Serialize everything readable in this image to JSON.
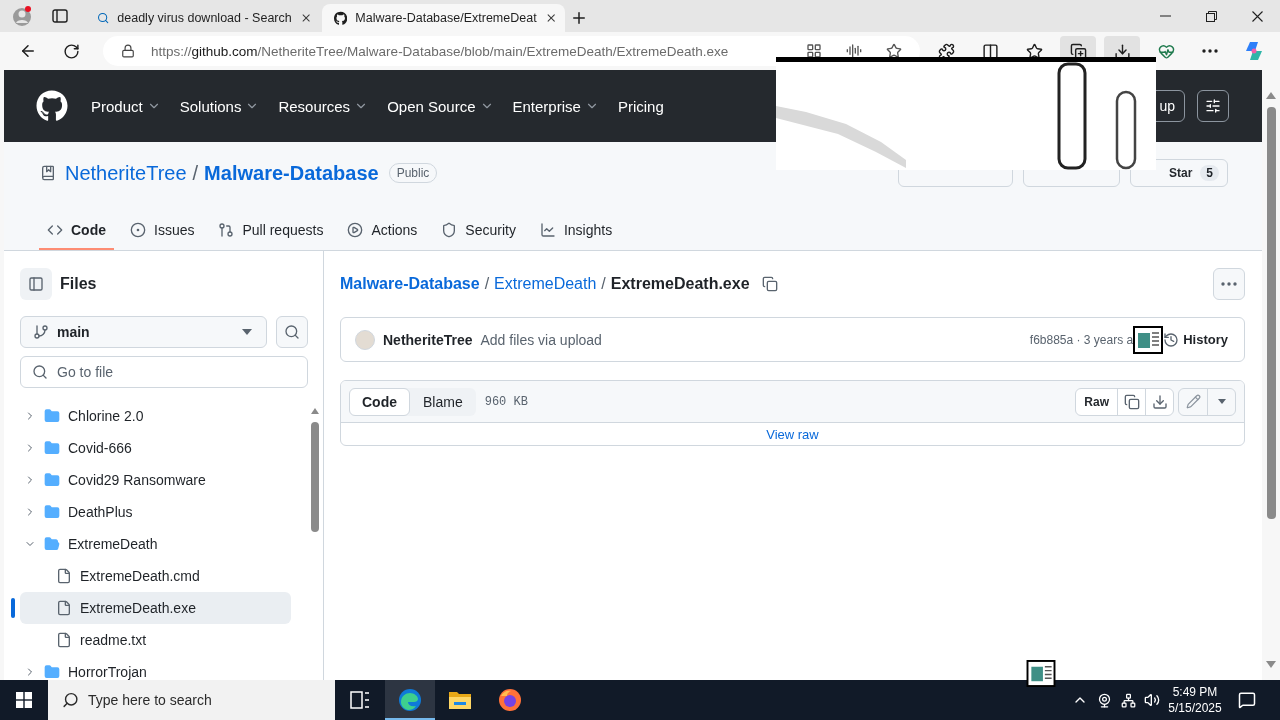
{
  "browser": {
    "tabs": [
      {
        "kind": "search",
        "title": "deadly virus download - Search",
        "selected": false
      },
      {
        "kind": "github",
        "title": "Malware-Database/ExtremeDeat",
        "selected": true
      }
    ],
    "address": {
      "scheme": "https://",
      "host": "github.com",
      "path": "/NetheriteTree/Malware-Database/blob/main/ExtremeDeath/ExtremeDeath.exe"
    }
  },
  "github_header": {
    "nav": [
      {
        "label": "Product",
        "dropdown": true
      },
      {
        "label": "Solutions",
        "dropdown": true
      },
      {
        "label": "Resources",
        "dropdown": true
      },
      {
        "label": "Open Source",
        "dropdown": true
      },
      {
        "label": "Enterprise",
        "dropdown": true
      },
      {
        "label": "Pricing",
        "dropdown": false
      }
    ],
    "sign_up": "up"
  },
  "repo": {
    "owner": "NetheriteTree",
    "separator": "/",
    "name": "Malware-Database",
    "visibility": "Public",
    "star": {
      "label": "Star",
      "count": "5"
    },
    "tabs": [
      {
        "kind": "code",
        "label": "Code",
        "selected": true
      },
      {
        "kind": "issues",
        "label": "Issues",
        "selected": false
      },
      {
        "kind": "pulls",
        "label": "Pull requests",
        "selected": false
      },
      {
        "kind": "actions",
        "label": "Actions",
        "selected": false
      },
      {
        "kind": "security",
        "label": "Security",
        "selected": false
      },
      {
        "kind": "insights",
        "label": "Insights",
        "selected": false
      }
    ]
  },
  "sidebar": {
    "title": "Files",
    "branch": "main",
    "search": {
      "placeholder": "Go to file"
    },
    "tree": [
      {
        "kind": "folder",
        "name": "Chlorine 2.0",
        "expanded": false,
        "selected": false
      },
      {
        "kind": "folder",
        "name": "Covid-666",
        "expanded": false,
        "selected": false
      },
      {
        "kind": "folder",
        "name": "Covid29 Ransomware",
        "expanded": false,
        "selected": false
      },
      {
        "kind": "folder",
        "name": "DeathPlus",
        "expanded": false,
        "selected": false
      },
      {
        "kind": "folder",
        "name": "ExtremeDeath",
        "expanded": true,
        "selected": false,
        "children": [
          {
            "kind": "file",
            "name": "ExtremeDeath.cmd",
            "selected": false
          },
          {
            "kind": "file",
            "name": "ExtremeDeath.exe",
            "selected": true
          },
          {
            "kind": "file",
            "name": "readme.txt",
            "selected": false
          }
        ]
      },
      {
        "kind": "folder",
        "name": "HorrorTrojan",
        "expanded": false,
        "selected": false
      }
    ]
  },
  "file": {
    "separator": "/",
    "breadcrumb": [
      {
        "kind": "repo",
        "label": "Malware-Database"
      },
      {
        "kind": "folder",
        "label": "ExtremeDeath"
      },
      {
        "kind": "current",
        "label": "ExtremeDeath.exe"
      }
    ],
    "commit": {
      "author": "NetheriteTree",
      "message": "Add files via upload",
      "meta": "f6b885a · 3 years a",
      "history": "History"
    },
    "view_tabs": [
      {
        "label": "Code",
        "selected": true
      },
      {
        "label": "Blame",
        "selected": false
      }
    ],
    "size": "960 KB",
    "raw": "Raw",
    "view_raw": "View raw"
  },
  "taskbar": {
    "search": {
      "placeholder": "Type here to search"
    },
    "apps": [
      {
        "kind": "task-view",
        "running": false
      },
      {
        "kind": "edge",
        "running": true
      },
      {
        "kind": "explorer",
        "running": false
      },
      {
        "kind": "firefox",
        "running": false
      }
    ],
    "time": "5:49 PM",
    "date": "5/15/2025"
  }
}
